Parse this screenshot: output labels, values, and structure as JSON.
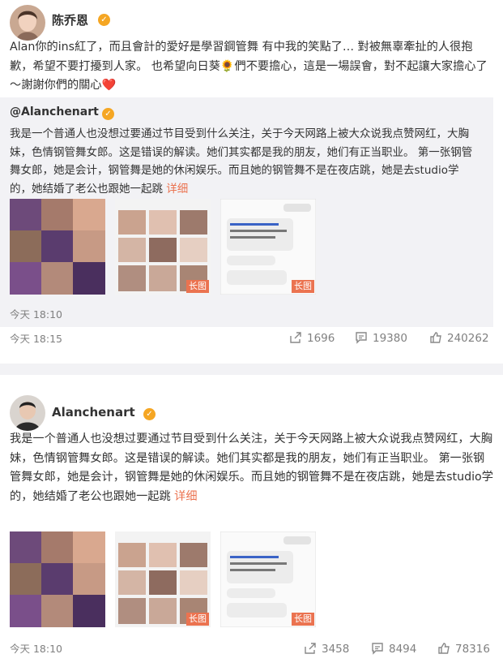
{
  "post1": {
    "author": "陈乔恩",
    "text": "Alan你的ins紅了，而且會計的愛好是學習鋼管舞 有中我的笑點了… 對被無辜牽扯的人很抱歉，希望不要打擾到人家。 也希望向日葵🌻們不要擔心，這是一場誤會，對不起讓大家擔心了～謝謝你們的關心❤️",
    "repost": {
      "author": "@Alanchenart",
      "text": "我是一个普通人也没想过要通过节目受到什么关注，关于今天网路上被大众说我点赞网红，大胸妹，色情钢管舞女郎。这是错误的解读。她们其实都是我的朋友，她们有正当职业。 第一张钢管舞女郎，她是会计，钢管舞是她的休闲娱乐。而且她的钢管舞不是在夜店跳，她是去studio学的，她结婚了老公也跟她一起跳",
      "more": "详细",
      "time": "今天 18:10",
      "long_image_tag": "长图"
    },
    "time": "今天 18:15",
    "stats": {
      "repost": "1696",
      "comment": "19380",
      "like": "240262"
    }
  },
  "post2": {
    "author": "Alanchenart",
    "text": "我是一个普通人也没想过要通过节目受到什么关注，关于今天网路上被大众说我点赞网红，大胸妹，色情钢管舞女郎。这是错误的解读。她们其实都是我的朋友，她们有正当职业。 第一张钢管舞女郎，她是会计，钢管舞是她的休闲娱乐。而且她的钢管舞不是在夜店跳，她是去studio学的，她结婚了老公也跟她一起跳",
    "more": "详细",
    "long_image_tag": "长图",
    "time": "今天 18:10",
    "stats": {
      "repost": "3458",
      "comment": "8494",
      "like": "78316"
    }
  },
  "icons": {
    "verified": "verified-badge-icon",
    "repost": "share-icon",
    "comment": "comment-icon",
    "like": "like-icon"
  },
  "colors": {
    "accent": "#eb7350",
    "verified": "#f5a623",
    "muted": "#808080",
    "repost_bg": "#f2f2f5"
  }
}
